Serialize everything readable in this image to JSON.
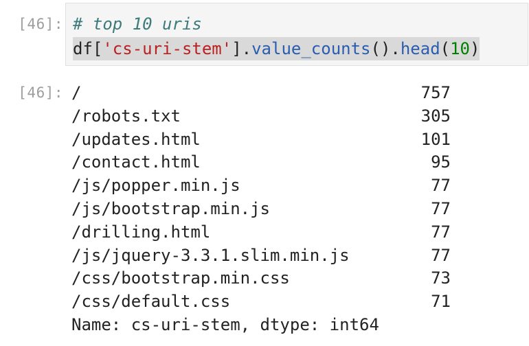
{
  "input_cell": {
    "prompt": "[46]:",
    "comment": "# top 10 uris",
    "code": {
      "df": "df",
      "bracket_open": "[",
      "string": "'cs-uri-stem'",
      "bracket_close": "].",
      "method1": "value_counts",
      "parens1": "().",
      "method2": "head",
      "paren_open": "(",
      "arg": "10",
      "paren_close": ")"
    }
  },
  "output_cell": {
    "prompt": "[46]:",
    "rows": [
      {
        "uri": "/",
        "count": "757"
      },
      {
        "uri": "/robots.txt",
        "count": "305"
      },
      {
        "uri": "/updates.html",
        "count": "101"
      },
      {
        "uri": "/contact.html",
        "count": "95"
      },
      {
        "uri": "/js/popper.min.js",
        "count": "77"
      },
      {
        "uri": "/js/bootstrap.min.js",
        "count": "77"
      },
      {
        "uri": "/drilling.html",
        "count": "77"
      },
      {
        "uri": "/js/jquery-3.3.1.slim.min.js",
        "count": "77"
      },
      {
        "uri": "/css/bootstrap.min.css",
        "count": "73"
      },
      {
        "uri": "/css/default.css",
        "count": "71"
      }
    ],
    "footer": "Name: cs-uri-stem, dtype: int64"
  },
  "colors": {
    "comment": "#3d7b7b",
    "string": "#ba2121",
    "attribute": "#2a5db0",
    "number": "#008000",
    "prompt": "#9e9e9e",
    "cell_background": "#f5f5f5"
  }
}
